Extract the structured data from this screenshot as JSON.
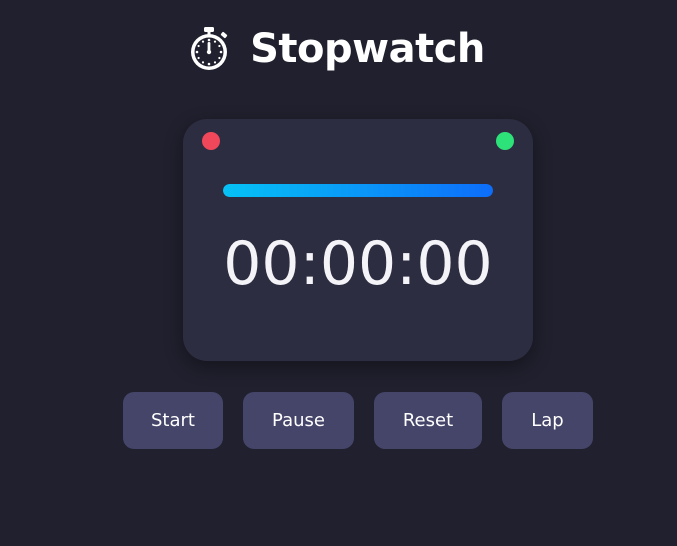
{
  "header": {
    "title": "Stopwatch",
    "icon": "stopwatch-icon"
  },
  "display": {
    "time": "00:00:00",
    "progress": 1.0
  },
  "indicators": {
    "left_color": "#f0475a",
    "right_color": "#2ee27a"
  },
  "controls": {
    "start_label": "Start",
    "pause_label": "Pause",
    "reset_label": "Reset",
    "lap_label": "Lap"
  },
  "colors": {
    "background": "#20202e",
    "card": "#2d2d42",
    "button": "#45456a",
    "progress_start": "#06c2f5",
    "progress_end": "#0d6dfa"
  }
}
